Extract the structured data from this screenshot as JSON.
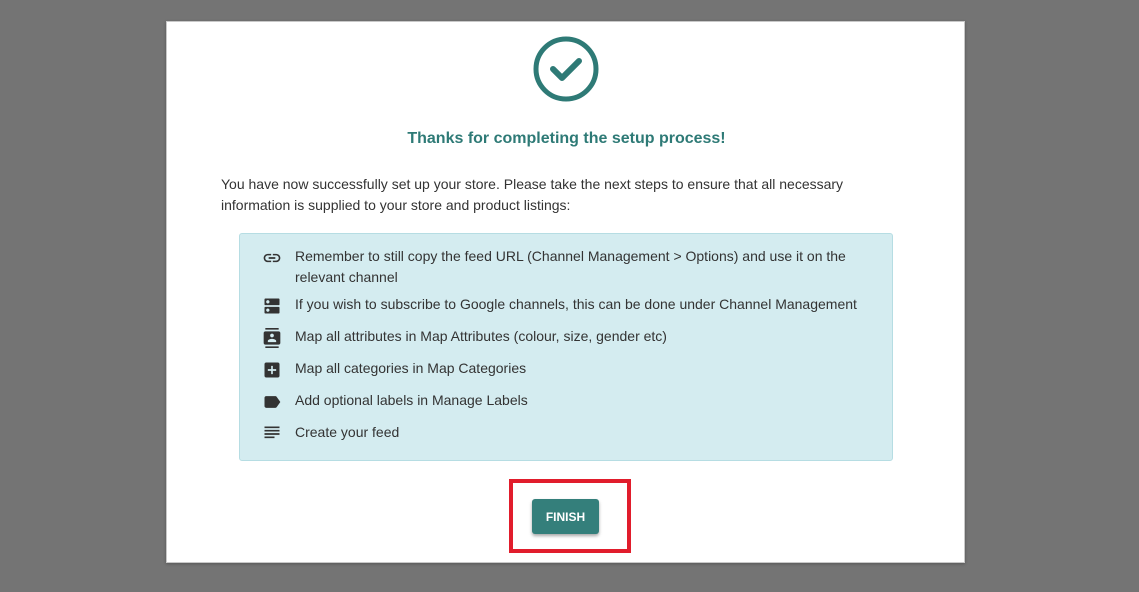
{
  "modal": {
    "title": "Thanks for completing the setup process!",
    "intro": "You have now successfully set up your store. Please take the next steps to ensure that all necessary information is supplied to your store and product listings:",
    "steps": [
      {
        "icon": "link-icon",
        "text": "Remember to still copy the feed URL (Channel Management > Options) and use it on the relevant channel"
      },
      {
        "icon": "server-icon",
        "text": "If you wish to subscribe to Google channels, this can be done under Channel Management"
      },
      {
        "icon": "contact-card-icon",
        "text": "Map all attributes in Map Attributes (colour, size, gender etc)"
      },
      {
        "icon": "plus-box-icon",
        "text": "Map all categories in Map Categories"
      },
      {
        "icon": "label-icon",
        "text": "Add optional labels in Manage Labels"
      },
      {
        "icon": "list-icon",
        "text": "Create your feed"
      }
    ],
    "finish_label": "FINISH"
  },
  "colors": {
    "accent": "#2e7a76",
    "button": "#347f7b",
    "panel_bg": "#d4ecf0",
    "highlight": "#e11d2c",
    "overlay": "#747474"
  }
}
